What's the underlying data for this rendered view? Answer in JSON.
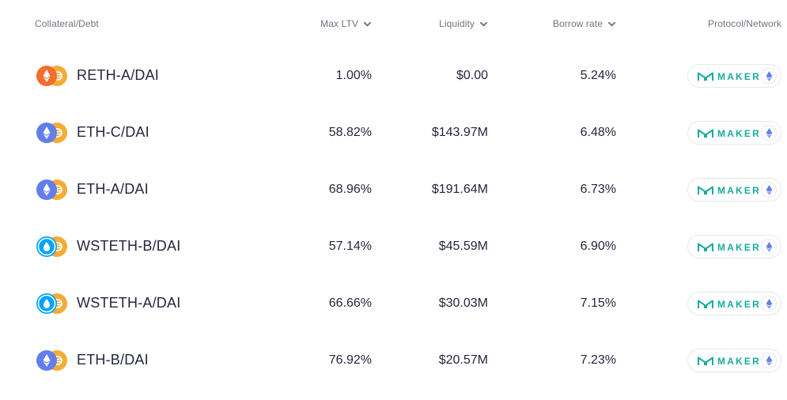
{
  "header": {
    "collateral_debt": "Collateral/Debt",
    "max_ltv": "Max LTV",
    "liquidity": "Liquidity",
    "borrow_rate": "Borrow rate",
    "protocol_network": "Protocol/Network"
  },
  "colors": {
    "maker_green": "#1aab9b",
    "dai": "#f5ac37",
    "reth": "#f36d2b",
    "eth": "#627eea",
    "wsteth": "#00a3ff"
  },
  "rows": [
    {
      "name": "RETH-A/DAI",
      "collateral_icon": "reth-icon",
      "debt_icon": "dai-icon",
      "max_ltv": "1.00%",
      "liquidity": "$0.00",
      "borrow_rate": "5.24%",
      "protocol": "MAKER",
      "network_icon": "ethereum-icon"
    },
    {
      "name": "ETH-C/DAI",
      "collateral_icon": "eth-icon",
      "debt_icon": "dai-icon",
      "max_ltv": "58.82%",
      "liquidity": "$143.97M",
      "borrow_rate": "6.48%",
      "protocol": "MAKER",
      "network_icon": "ethereum-icon"
    },
    {
      "name": "ETH-A/DAI",
      "collateral_icon": "eth-icon",
      "debt_icon": "dai-icon",
      "max_ltv": "68.96%",
      "liquidity": "$191.64M",
      "borrow_rate": "6.73%",
      "protocol": "MAKER",
      "network_icon": "ethereum-icon"
    },
    {
      "name": "WSTETH-B/DAI",
      "collateral_icon": "wsteth-icon",
      "debt_icon": "dai-icon",
      "max_ltv": "57.14%",
      "liquidity": "$45.59M",
      "borrow_rate": "6.90%",
      "protocol": "MAKER",
      "network_icon": "ethereum-icon"
    },
    {
      "name": "WSTETH-A/DAI",
      "collateral_icon": "wsteth-icon",
      "debt_icon": "dai-icon",
      "max_ltv": "66.66%",
      "liquidity": "$30.03M",
      "borrow_rate": "7.15%",
      "protocol": "MAKER",
      "network_icon": "ethereum-icon"
    },
    {
      "name": "ETH-B/DAI",
      "collateral_icon": "eth-icon",
      "debt_icon": "dai-icon",
      "max_ltv": "76.92%",
      "liquidity": "$20.57M",
      "borrow_rate": "7.23%",
      "protocol": "MAKER",
      "network_icon": "ethereum-icon"
    }
  ]
}
